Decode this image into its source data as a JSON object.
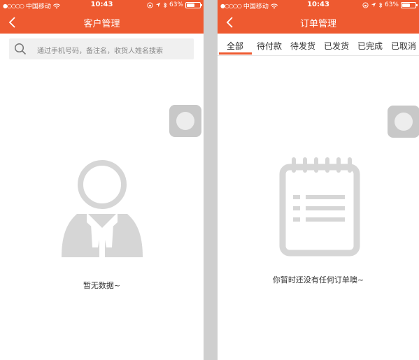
{
  "left": {
    "status": {
      "carrier": "中国移动",
      "time": "10:43",
      "battery": "63%"
    },
    "nav": {
      "title": "客户管理"
    },
    "search": {
      "placeholder": "通过手机号码，备注名，收货人姓名搜索"
    },
    "empty": {
      "text": "暂无数据~"
    }
  },
  "right": {
    "status": {
      "carrier": "中国移动",
      "time": "10:43",
      "battery": "63%"
    },
    "nav": {
      "title": "订单管理"
    },
    "tabs": [
      {
        "label": "全部",
        "active": true
      },
      {
        "label": "待付款"
      },
      {
        "label": "待发货"
      },
      {
        "label": "已发货"
      },
      {
        "label": "已完成"
      },
      {
        "label": "已取消"
      }
    ],
    "empty": {
      "text": "你暂时还没有任何订单噢~"
    }
  },
  "colors": {
    "accent": "#ee5a30",
    "icon_gray": "#d6d6d6"
  },
  "icons": [
    "back-chevron-icon",
    "search-icon",
    "wifi-icon",
    "lock-rotation-icon",
    "location-icon",
    "bluetooth-icon",
    "battery-icon",
    "person-icon",
    "notepad-icon"
  ]
}
